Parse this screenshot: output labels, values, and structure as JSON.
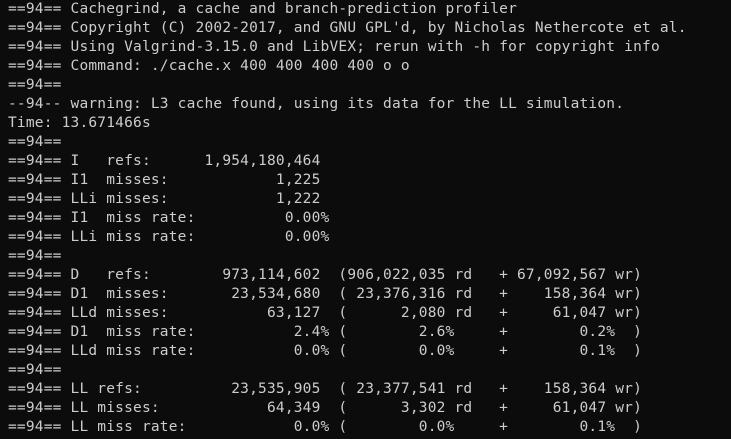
{
  "theme": {
    "background": "#0c0c0c",
    "foreground": "#cccccc"
  },
  "terminal": {
    "lines": [
      "==94== Cachegrind, a cache and branch-prediction profiler",
      "==94== Copyright (C) 2002-2017, and GNU GPL'd, by Nicholas Nethercote et al.",
      "==94== Using Valgrind-3.15.0 and LibVEX; rerun with -h for copyright info",
      "==94== Command: ./cache.x 400 400 400 400 o o",
      "==94==",
      "--94-- warning: L3 cache found, using its data for the LL simulation.",
      "Time: 13.671466s",
      "==94==",
      "==94== I   refs:      1,954,180,464",
      "==94== I1  misses:            1,225",
      "==94== LLi misses:            1,222",
      "==94== I1  miss rate:          0.00%",
      "==94== LLi miss rate:          0.00%",
      "==94==",
      "==94== D   refs:        973,114,602  (906,022,035 rd   + 67,092,567 wr)",
      "==94== D1  misses:       23,534,680  ( 23,376,316 rd   +    158,364 wr)",
      "==94== LLd misses:           63,127  (      2,080 rd   +     61,047 wr)",
      "==94== D1  miss rate:           2.4% (        2.6%     +        0.2%  )",
      "==94== LLd miss rate:           0.0% (        0.0%     +        0.1%  )",
      "==94==",
      "==94== LL refs:          23,535,905  ( 23,377,541 rd   +    158,364 wr)",
      "==94== LL misses:            64,349  (      3,302 rd   +     61,047 wr)",
      "==94== LL miss rate:            0.0% (        0.0%     +        0.1%  )"
    ]
  }
}
